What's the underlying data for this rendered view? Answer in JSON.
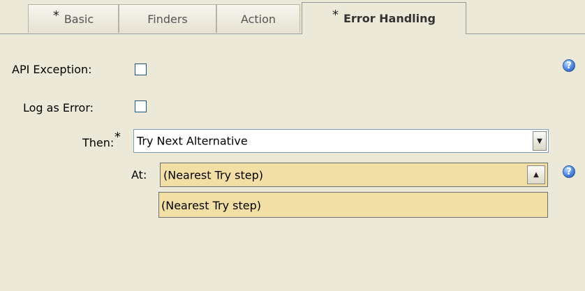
{
  "tabs": [
    {
      "label": "Basic",
      "required": true
    },
    {
      "label": "Finders",
      "required": false
    },
    {
      "label": "Action",
      "required": false
    },
    {
      "label": "Error Handling",
      "required": true,
      "active": true
    }
  ],
  "required_marker": "*",
  "form": {
    "api_exception_label": "API Exception:",
    "api_exception_checked": false,
    "log_as_error_label": "Log as Error:",
    "log_as_error_checked": false,
    "then_label": "Then:",
    "then_value": "Try Next Alternative",
    "at_label": "At:",
    "at_value": "(Nearest Try step)",
    "at_options": [
      "(Nearest Try step)"
    ]
  },
  "help_glyph": "?",
  "colors": {
    "background": "#ece9d8",
    "dropdown_highlight": "#f2dfa5",
    "help_blue": "#4f86d9"
  }
}
